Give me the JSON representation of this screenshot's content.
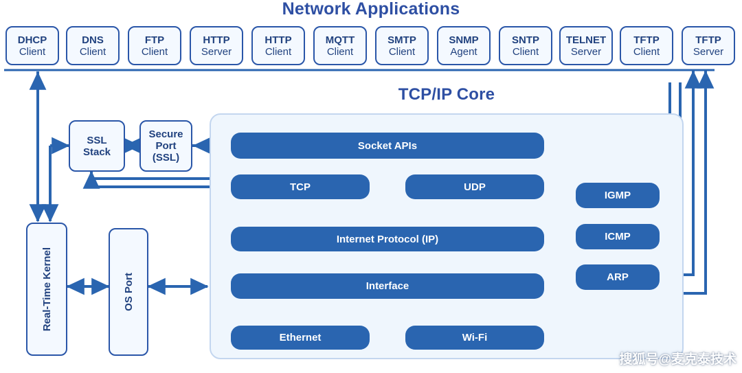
{
  "titles": {
    "network_applications": "Network Applications",
    "tcpip_core": "TCP/IP Core"
  },
  "colors": {
    "title_blue": "#2e4fa3",
    "box_fill_blue": "#2a65b0",
    "outline_blue": "#2a56a8",
    "panel_bg": "#eff6fd",
    "panel_border": "#c3d6ef",
    "light_box_bg": "#f4f9ff",
    "wire_blue": "#2a65b0"
  },
  "applications": [
    {
      "line1": "DHCP",
      "line2": "Client"
    },
    {
      "line1": "DNS",
      "line2": "Client"
    },
    {
      "line1": "FTP",
      "line2": "Client"
    },
    {
      "line1": "HTTP",
      "line2": "Server"
    },
    {
      "line1": "HTTP",
      "line2": "Client"
    },
    {
      "line1": "MQTT",
      "line2": "Client"
    },
    {
      "line1": "SMTP",
      "line2": "Client"
    },
    {
      "line1": "SNMP",
      "line2": "Agent"
    },
    {
      "line1": "SNTP",
      "line2": "Client"
    },
    {
      "line1": "TELNET",
      "line2": "Server"
    },
    {
      "line1": "TFTP",
      "line2": "Client"
    },
    {
      "line1": "TFTP",
      "line2": "Server"
    }
  ],
  "security": {
    "ssl_stack": "SSL\nStack",
    "ssl_stack_l1": "SSL",
    "ssl_stack_l2": "Stack",
    "secure_port_l1": "Secure",
    "secure_port_l2": "Port",
    "secure_port_l3": "(SSL)"
  },
  "platform": {
    "kernel": "Real-Time Kernel",
    "os_port": "OS Port"
  },
  "core_blocks": {
    "socket_apis": "Socket APIs",
    "tcp": "TCP",
    "udp": "UDP",
    "ip": "Internet Protocol (IP)",
    "interface": "Interface",
    "ethernet": "Ethernet",
    "wifi": "Wi-Fi"
  },
  "side_protocols": {
    "igmp": "IGMP",
    "icmp": "ICMP",
    "arp": "ARP"
  },
  "watermark": "搜狐号@麦克泰技术"
}
